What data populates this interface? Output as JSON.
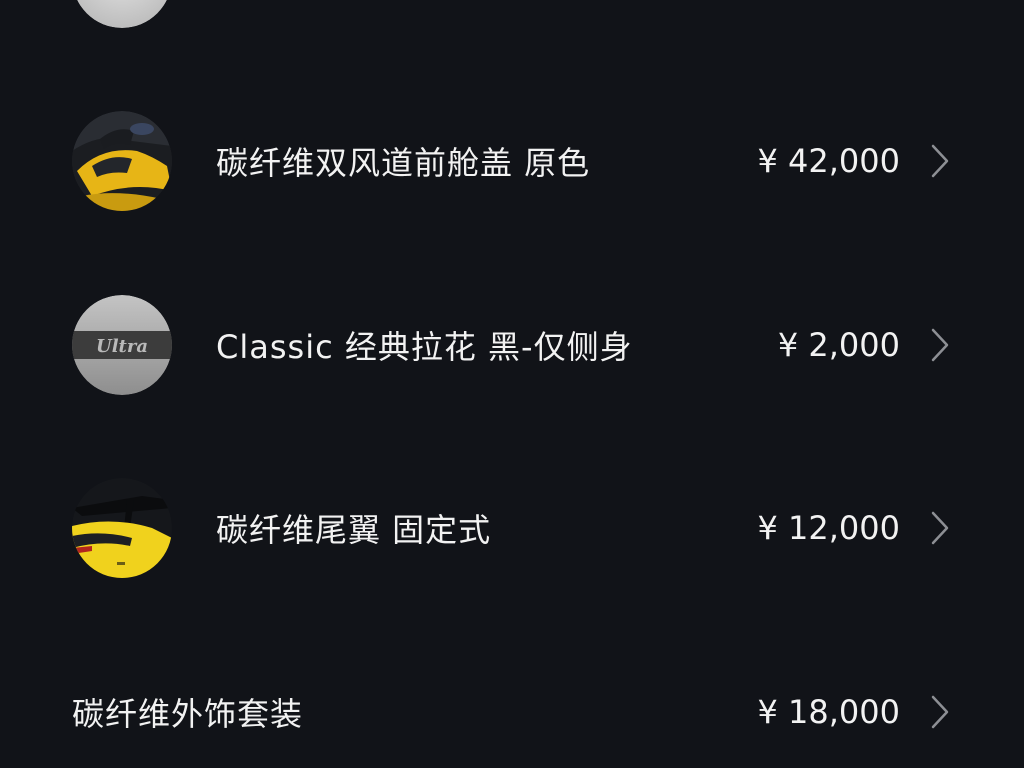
{
  "icons": {
    "chevron": "chevron-right-icon"
  },
  "colors": {
    "background": "#111318",
    "text": "#f2f2f2",
    "chevron": "#8d8f94"
  },
  "items": [
    {
      "title": "碳纤维双风道前舱盖 原色",
      "price": "¥ 42,000"
    },
    {
      "title": "Classic 经典拉花 黑-仅侧身",
      "price": "¥ 2,000",
      "thumb_text": "Ultra"
    },
    {
      "title": "碳纤维尾翼 固定式",
      "price": "¥ 12,000"
    },
    {
      "title": "碳纤维外饰套装",
      "price": "¥ 18,000"
    }
  ]
}
